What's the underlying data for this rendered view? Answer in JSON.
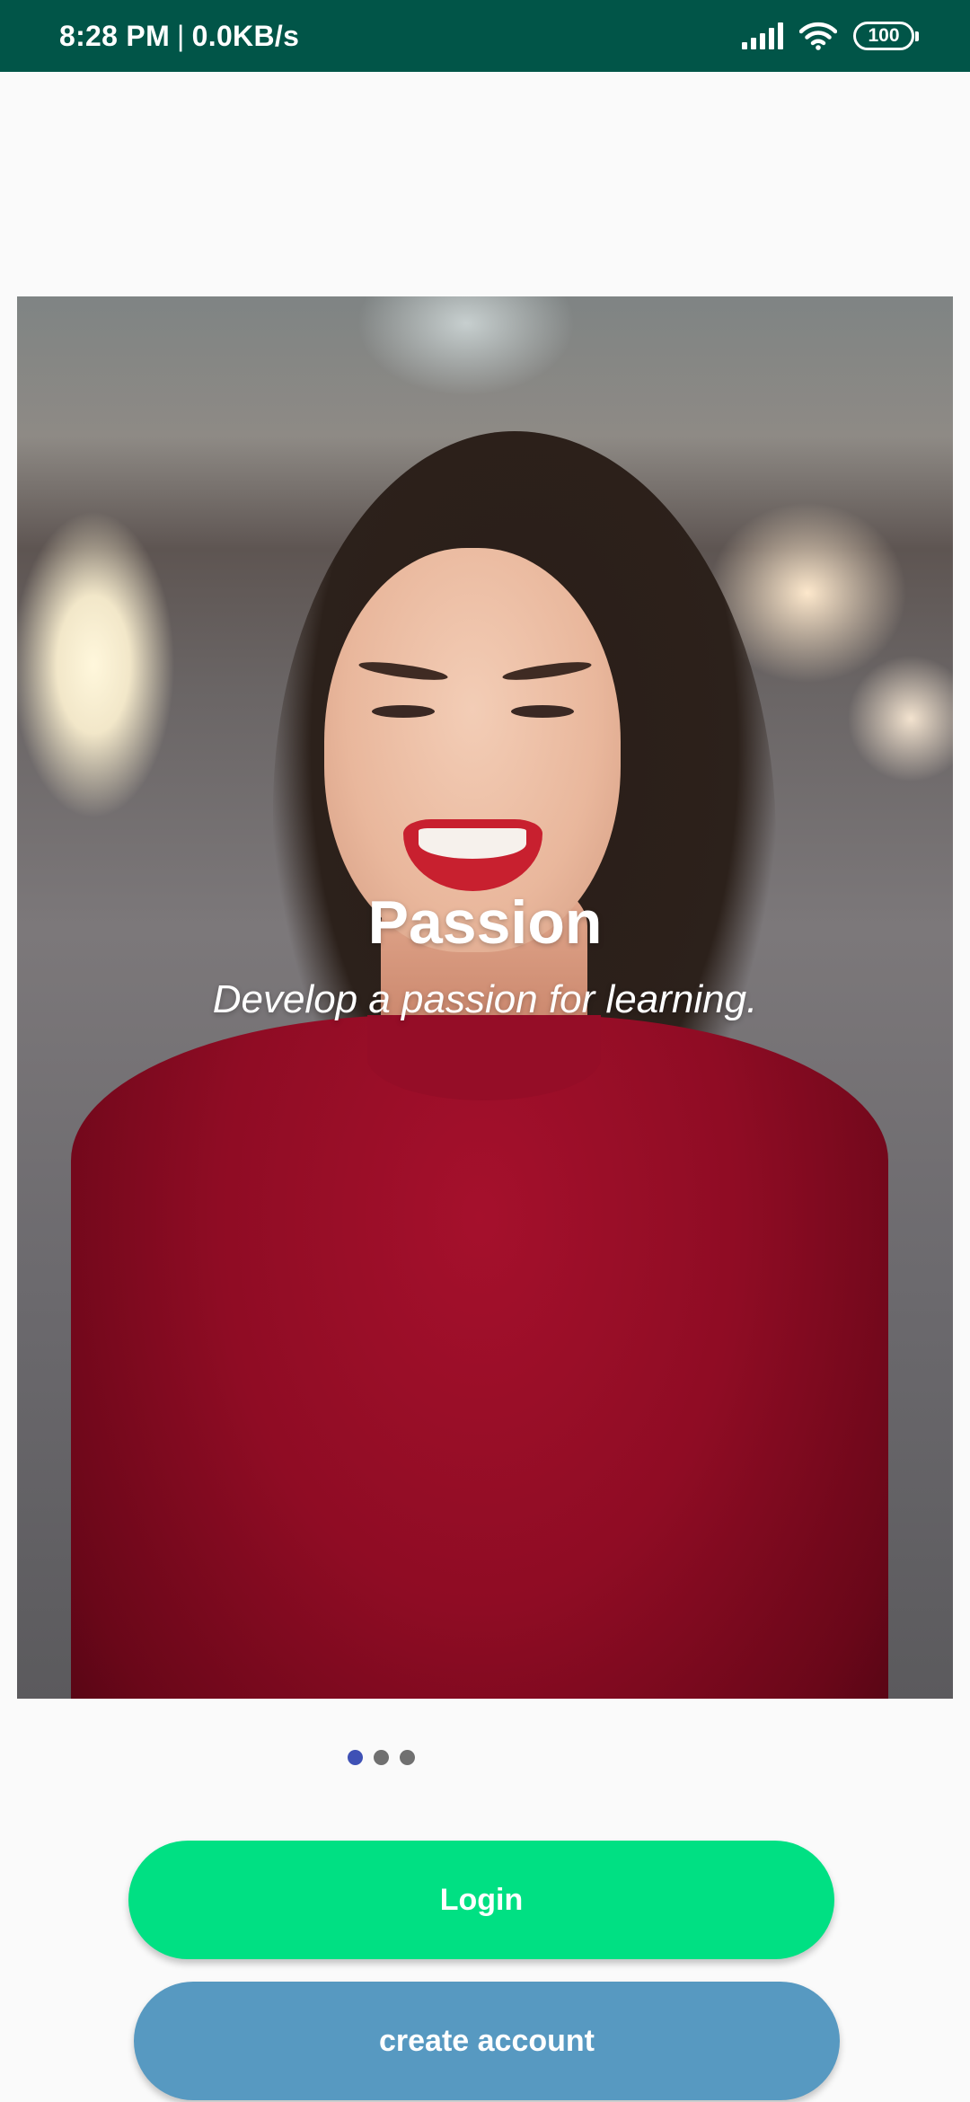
{
  "status_bar": {
    "time": "8:28 PM",
    "separator": "|",
    "network_speed": "0.0KB/s",
    "battery_level": "100",
    "icons": [
      "signal-icon",
      "wifi-icon",
      "battery-icon"
    ],
    "background_color": "#015548"
  },
  "carousel": {
    "slide_title": "Passion",
    "slide_subtitle": "Develop a passion for learning.",
    "slide_count": 3,
    "active_index": 0,
    "active_dot_color": "#3f51b5",
    "inactive_dot_color": "#707070"
  },
  "actions": {
    "login_label": "Login",
    "login_color": "#00e083",
    "create_account_label": "create account",
    "create_account_color": "#5799c1"
  }
}
